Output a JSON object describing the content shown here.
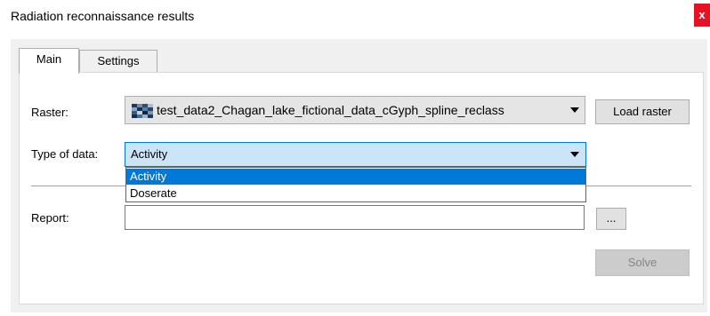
{
  "window": {
    "title": "Radiation reconnaissance results",
    "close_label": "x",
    "close_color": "#e81123"
  },
  "tabs": [
    {
      "label": "Main",
      "active": true
    },
    {
      "label": "Settings",
      "active": false
    }
  ],
  "raster": {
    "label": "Raster:",
    "selected": "test_data2_Chagan_lake_fictional_data_cGyph_spline_reclass",
    "icon": "raster-layer-icon",
    "load_button": "Load raster"
  },
  "type_of_data": {
    "label": "Type of data:",
    "selected": "Activity",
    "options": [
      "Activity",
      "Doserate"
    ],
    "highlight_color": "#0078d7"
  },
  "report": {
    "label": "Report:",
    "value": "",
    "browse_button": "..."
  },
  "solve_button": "Solve"
}
